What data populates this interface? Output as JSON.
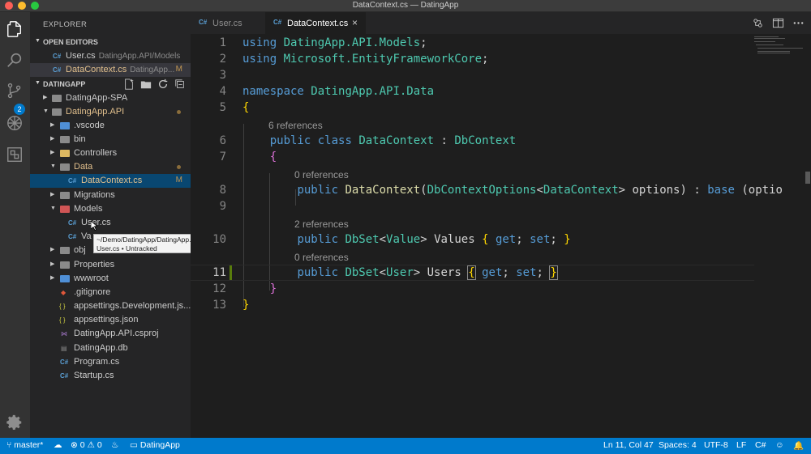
{
  "window": {
    "title": "DataContext.cs — DatingApp"
  },
  "activity_bar": {
    "items": [
      "explorer-icon",
      "search-icon",
      "source-control-icon",
      "debug-icon",
      "extensions-icon",
      "gear-icon"
    ],
    "scm_badge": "2"
  },
  "sidebar": {
    "title": "EXPLORER",
    "open_editors": {
      "label": "OPEN EDITORS",
      "items": [
        {
          "name": "User.cs",
          "desc": "DatingApp.API/Models",
          "badge": ""
        },
        {
          "name": "DataContext.cs",
          "desc": "DatingApp...",
          "badge": "M"
        }
      ]
    },
    "workspace": {
      "label": "DATINGAPP",
      "tree": [
        {
          "name": "DatingApp-SPA"
        },
        {
          "name": "DatingApp.API"
        },
        {
          "name": ".vscode"
        },
        {
          "name": "bin"
        },
        {
          "name": "Controllers"
        },
        {
          "name": "Data"
        },
        {
          "name": "DataContext.cs",
          "badge": "M"
        },
        {
          "name": "Migrations"
        },
        {
          "name": "Models"
        },
        {
          "name": "User.cs"
        },
        {
          "name": "Va"
        },
        {
          "name": "obj"
        },
        {
          "name": "Properties"
        },
        {
          "name": "wwwroot"
        },
        {
          "name": ".gitignore"
        },
        {
          "name": "appsettings.Development.js..."
        },
        {
          "name": "appsettings.json"
        },
        {
          "name": "DatingApp.API.csproj"
        },
        {
          "name": "DatingApp.db"
        },
        {
          "name": "Program.cs"
        },
        {
          "name": "Startup.cs"
        }
      ]
    },
    "tooltip": {
      "line1": "~/Demo/DatingApp/DatingApp.API/Models/",
      "line2": "User.cs • Untracked"
    }
  },
  "tabs": [
    {
      "icon": "C#",
      "label": "User.cs",
      "active": false
    },
    {
      "icon": "C#",
      "label": "DataContext.cs",
      "active": true,
      "close": "×"
    }
  ],
  "editor": {
    "line_numbers": [
      "1",
      "2",
      "3",
      "4",
      "5",
      "6",
      "7",
      "8",
      "9",
      "10",
      "11",
      "12",
      "13"
    ],
    "code_lens": {
      "class_refs": "6 references",
      "ctor_refs": "0 references",
      "values_refs": "2 references",
      "users_refs": "0 references"
    },
    "tokens": {
      "using": "using",
      "ns1": "DatingApp.API.Models",
      "ns2": "Microsoft.EntityFrameworkCore",
      "namespace": "namespace",
      "ns3": "DatingApp.API.Data",
      "public": "public",
      "class": "class",
      "classname": "DataContext",
      "base": "DbContext",
      "ctor_params": "DbContextOptions",
      "options": "options",
      "base_kw": "base",
      "optio": "(optio",
      "dbset": "DbSet",
      "value": "Value",
      "values": "Values",
      "get": "get",
      "set": "set",
      "user": "User",
      "users": "Users"
    }
  },
  "status_bar": {
    "branch": "master*",
    "errors": "0",
    "warnings": "0",
    "project": "DatingApp",
    "position": "Ln 11, Col 47",
    "spaces": "Spaces: 4",
    "encoding": "UTF-8",
    "eol": "LF",
    "language": "C#"
  }
}
